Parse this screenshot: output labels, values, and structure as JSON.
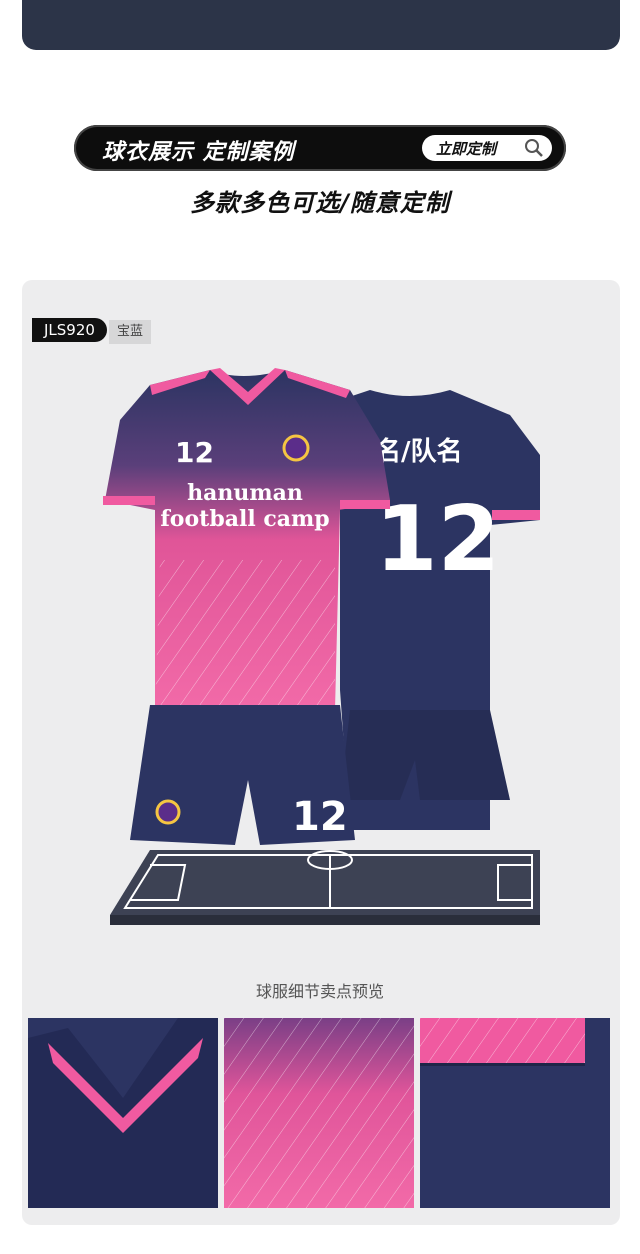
{
  "banner": {
    "title": "球衣展示  定制案例",
    "button_label": "立即定制",
    "button_icon": "search-icon"
  },
  "subtitle": "多款多色可选/随意定制",
  "product": {
    "model_code": "JLS920",
    "color_name": "宝蓝",
    "front_number": "12",
    "front_text_line1": "hanuman",
    "front_text_line2": "football camp",
    "back_name": "名/队名",
    "back_number": "12",
    "shorts_number": "12"
  },
  "details": {
    "caption": "球服细节卖点预览"
  },
  "colors": {
    "navy": "#2c3462",
    "pink": "#f05aa0",
    "field": "#454a5c"
  }
}
